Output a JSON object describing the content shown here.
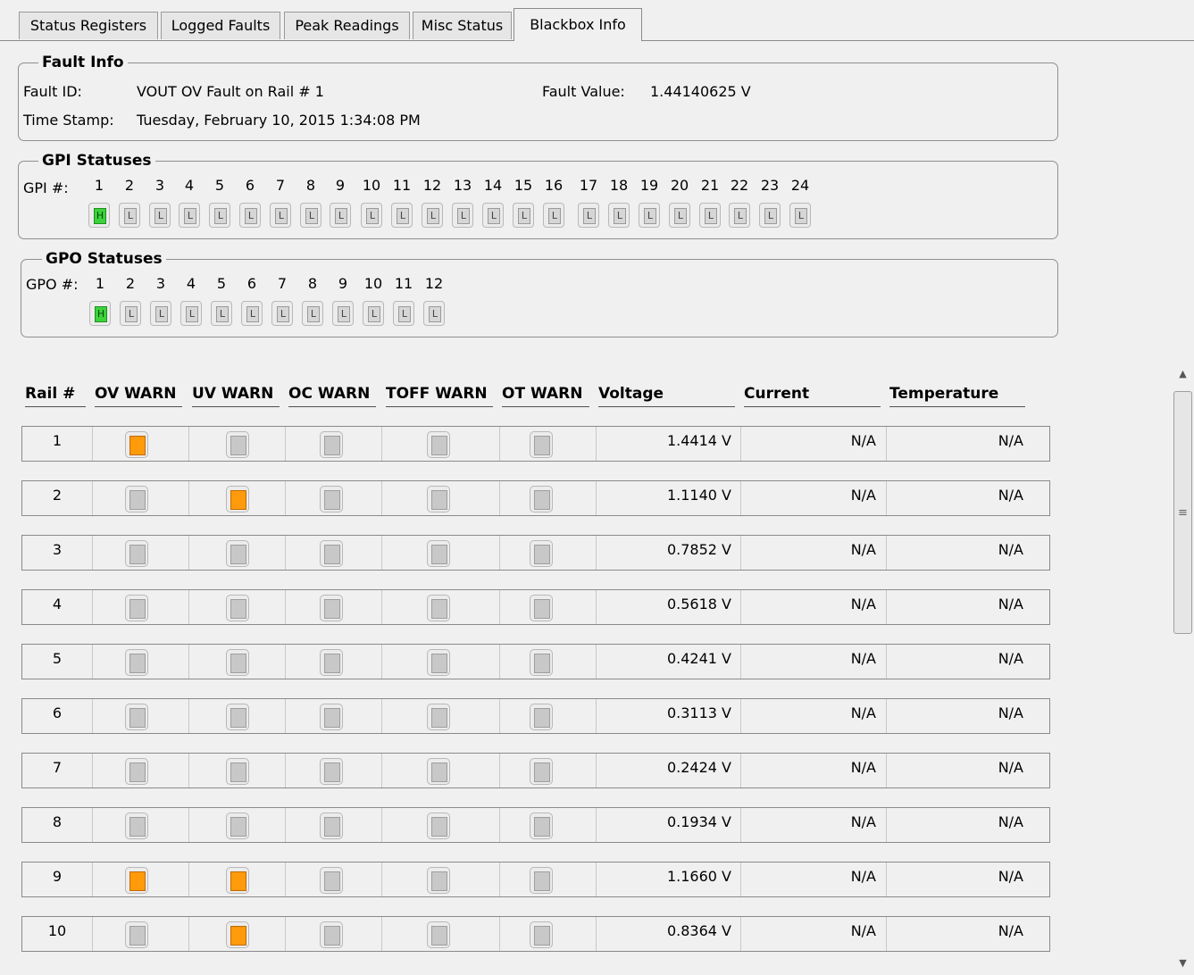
{
  "tabs": [
    {
      "label": "Status Registers",
      "active": false
    },
    {
      "label": "Logged Faults",
      "active": false
    },
    {
      "label": "Peak Readings",
      "active": false
    },
    {
      "label": "Misc Status",
      "active": false
    },
    {
      "label": "Blackbox Info",
      "active": true
    }
  ],
  "fault_info": {
    "title": "Fault Info",
    "fault_id_label": "Fault ID:",
    "fault_id": "VOUT OV Fault on Rail # 1",
    "fault_value_label": "Fault Value:",
    "fault_value": "1.44140625 V",
    "timestamp_label": "Time Stamp:",
    "timestamp": "Tuesday, February 10, 2015 1:34:08 PM"
  },
  "gpi": {
    "title": "GPI Statuses",
    "label": "GPI #:",
    "pins": [
      {
        "n": "1",
        "state": "H"
      },
      {
        "n": "2",
        "state": "L"
      },
      {
        "n": "3",
        "state": "L"
      },
      {
        "n": "4",
        "state": "L"
      },
      {
        "n": "5",
        "state": "L"
      },
      {
        "n": "6",
        "state": "L"
      },
      {
        "n": "7",
        "state": "L"
      },
      {
        "n": "8",
        "state": "L"
      },
      {
        "n": "9",
        "state": "L"
      },
      {
        "n": "10",
        "state": "L"
      },
      {
        "n": "11",
        "state": "L"
      },
      {
        "n": "12",
        "state": "L"
      },
      {
        "n": "13",
        "state": "L"
      },
      {
        "n": "14",
        "state": "L"
      },
      {
        "n": "15",
        "state": "L"
      },
      {
        "n": "16",
        "state": "L"
      },
      {
        "n": "17",
        "state": "L"
      },
      {
        "n": "18",
        "state": "L"
      },
      {
        "n": "19",
        "state": "L"
      },
      {
        "n": "20",
        "state": "L"
      },
      {
        "n": "21",
        "state": "L"
      },
      {
        "n": "22",
        "state": "L"
      },
      {
        "n": "23",
        "state": "L"
      },
      {
        "n": "24",
        "state": "L"
      }
    ]
  },
  "gpo": {
    "title": "GPO Statuses",
    "label": "GPO #:",
    "pins": [
      {
        "n": "1",
        "state": "H"
      },
      {
        "n": "2",
        "state": "L"
      },
      {
        "n": "3",
        "state": "L"
      },
      {
        "n": "4",
        "state": "L"
      },
      {
        "n": "5",
        "state": "L"
      },
      {
        "n": "6",
        "state": "L"
      },
      {
        "n": "7",
        "state": "L"
      },
      {
        "n": "8",
        "state": "L"
      },
      {
        "n": "9",
        "state": "L"
      },
      {
        "n": "10",
        "state": "L"
      },
      {
        "n": "11",
        "state": "L"
      },
      {
        "n": "12",
        "state": "L"
      }
    ]
  },
  "rail_table": {
    "headers": [
      "Rail #",
      "OV WARN",
      "UV WARN",
      "OC WARN",
      "TOFF WARN",
      "OT WARN",
      "Voltage",
      "Current",
      "Temperature"
    ],
    "rows": [
      {
        "rail": "1",
        "ov": true,
        "uv": false,
        "oc": false,
        "toff": false,
        "ot": false,
        "voltage": "1.4414 V",
        "current": "N/A",
        "temperature": "N/A"
      },
      {
        "rail": "2",
        "ov": false,
        "uv": true,
        "oc": false,
        "toff": false,
        "ot": false,
        "voltage": "1.1140 V",
        "current": "N/A",
        "temperature": "N/A"
      },
      {
        "rail": "3",
        "ov": false,
        "uv": false,
        "oc": false,
        "toff": false,
        "ot": false,
        "voltage": "0.7852 V",
        "current": "N/A",
        "temperature": "N/A"
      },
      {
        "rail": "4",
        "ov": false,
        "uv": false,
        "oc": false,
        "toff": false,
        "ot": false,
        "voltage": "0.5618 V",
        "current": "N/A",
        "temperature": "N/A"
      },
      {
        "rail": "5",
        "ov": false,
        "uv": false,
        "oc": false,
        "toff": false,
        "ot": false,
        "voltage": "0.4241 V",
        "current": "N/A",
        "temperature": "N/A"
      },
      {
        "rail": "6",
        "ov": false,
        "uv": false,
        "oc": false,
        "toff": false,
        "ot": false,
        "voltage": "0.3113 V",
        "current": "N/A",
        "temperature": "N/A"
      },
      {
        "rail": "7",
        "ov": false,
        "uv": false,
        "oc": false,
        "toff": false,
        "ot": false,
        "voltage": "0.2424 V",
        "current": "N/A",
        "temperature": "N/A"
      },
      {
        "rail": "8",
        "ov": false,
        "uv": false,
        "oc": false,
        "toff": false,
        "ot": false,
        "voltage": "0.1934 V",
        "current": "N/A",
        "temperature": "N/A"
      },
      {
        "rail": "9",
        "ov": true,
        "uv": true,
        "oc": false,
        "toff": false,
        "ot": false,
        "voltage": "1.1660 V",
        "current": "N/A",
        "temperature": "N/A"
      },
      {
        "rail": "10",
        "ov": false,
        "uv": true,
        "oc": false,
        "toff": false,
        "ot": false,
        "voltage": "0.8364 V",
        "current": "N/A",
        "temperature": "N/A"
      }
    ]
  },
  "colors": {
    "high": "#3cd23c",
    "warn_on": "#ff9a0a",
    "warn_off": "#c8c8c8"
  },
  "scrollbar": {
    "up_icon": "scroll-up-arrow",
    "down_icon": "scroll-down-arrow",
    "grip_icon": "grip-lines"
  }
}
